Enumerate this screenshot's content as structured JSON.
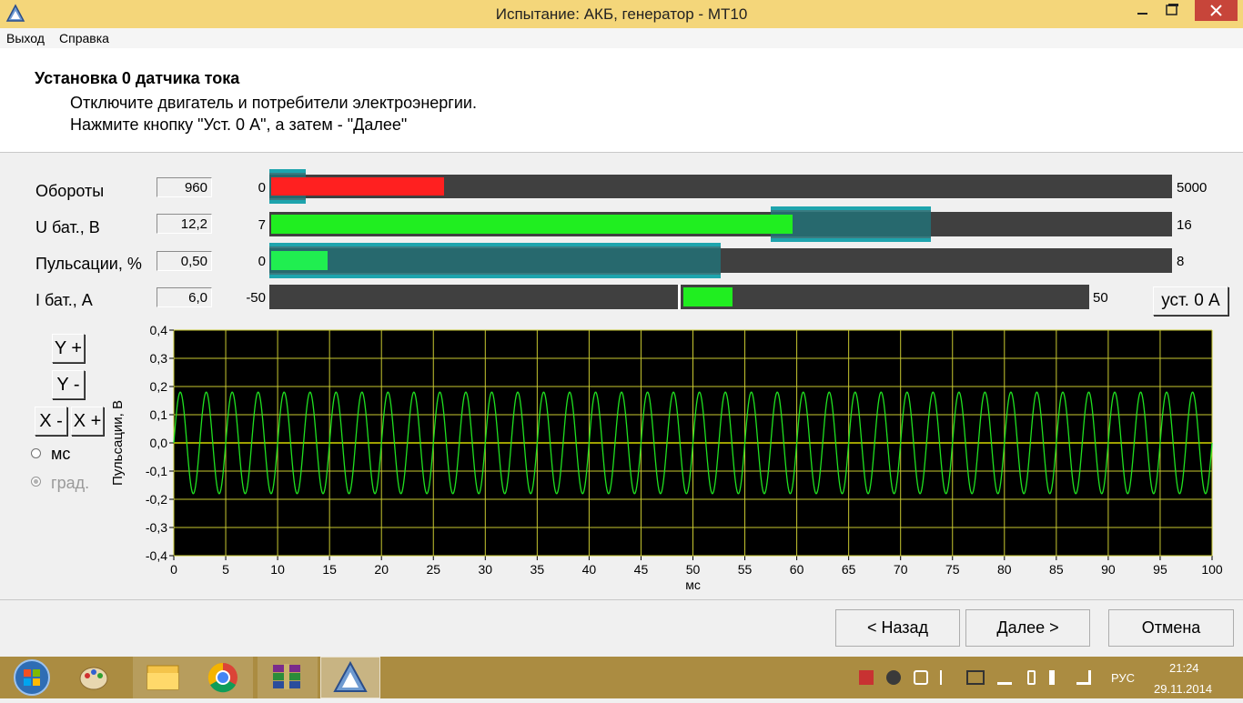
{
  "window": {
    "title": "Испытание: АКБ, генератор - МТ10"
  },
  "menu": {
    "items": [
      "Выход",
      "Справка"
    ]
  },
  "header": {
    "title": "Установка 0 датчика тока",
    "line1": "Отключите двигатель и потребители электроэнергии.",
    "line2": "Нажмите кнопку \"Уст. 0 А\", а затем - \"Далее\""
  },
  "gauges": [
    {
      "label": "Обороты",
      "value": "960",
      "min": "0",
      "max": "5000",
      "fill_from": 0,
      "fill_to": 960,
      "range_min": 0,
      "range_max": 5000,
      "zone": [
        0,
        200
      ],
      "fill_color": "#ff2020"
    },
    {
      "label": "U бат., В",
      "value": "12,2",
      "min": "7",
      "max": "16",
      "fill_from": 7,
      "fill_to": 12.2,
      "range_min": 7,
      "range_max": 16,
      "zone": [
        12.0,
        13.6
      ],
      "fill_color": "#20ee20"
    },
    {
      "label": "Пульсации, %",
      "value": "0,50",
      "min": "0",
      "max": "8",
      "fill_from": 0,
      "fill_to": 0.5,
      "range_min": 0,
      "range_max": 8,
      "zone": [
        0,
        4
      ],
      "fill_color": "#20ee50"
    },
    {
      "label": "I бат., А",
      "value": "6,0",
      "min": "-50",
      "max": "50",
      "fill_from": 0,
      "fill_to": 6,
      "range_min": -50,
      "range_max": 50,
      "zone": null,
      "fill_color": "#20ee20"
    }
  ],
  "set_zero_button": "уст. 0 А",
  "controls": {
    "y_plus": "Y +",
    "y_minus": "Y -",
    "x_minus": "X -",
    "x_plus": "X +",
    "radio_ms": "мс",
    "radio_deg": "град.",
    "selected_radio": "град."
  },
  "chart_data": {
    "type": "line",
    "xlabel": "мс",
    "ylabel": "Пульсации, В",
    "xlim": [
      0,
      100
    ],
    "ylim": [
      -0.4,
      0.4
    ],
    "x_ticks": [
      "0",
      "5",
      "10",
      "15",
      "20",
      "25",
      "30",
      "35",
      "40",
      "45",
      "50",
      "55",
      "60",
      "65",
      "70",
      "75",
      "80",
      "85",
      "90",
      "95",
      "100"
    ],
    "y_ticks": [
      "0,4",
      "0,3",
      "0,2",
      "0,1",
      "0,0",
      "-0,1",
      "-0,2",
      "-0,3",
      "-0,4"
    ],
    "grid": true,
    "background": "#000000",
    "grid_color": "#c8c830",
    "series": [
      {
        "color": "#20e020",
        "amplitude": 0.18,
        "period_ms": 2.5,
        "x_start": 0,
        "x_end": 100
      },
      {
        "color": "#a0a000",
        "constant": 0.0
      }
    ]
  },
  "nav": {
    "back": "< Назад",
    "next": "Далее >",
    "cancel": "Отмена"
  },
  "taskbar": {
    "apps": [
      "start-button",
      "paint-icon",
      "explorer-icon",
      "chrome-icon",
      "winrar-icon",
      "mt10-app-icon"
    ],
    "language": "РУС",
    "time": "21:24",
    "date": "29.11.2014"
  }
}
